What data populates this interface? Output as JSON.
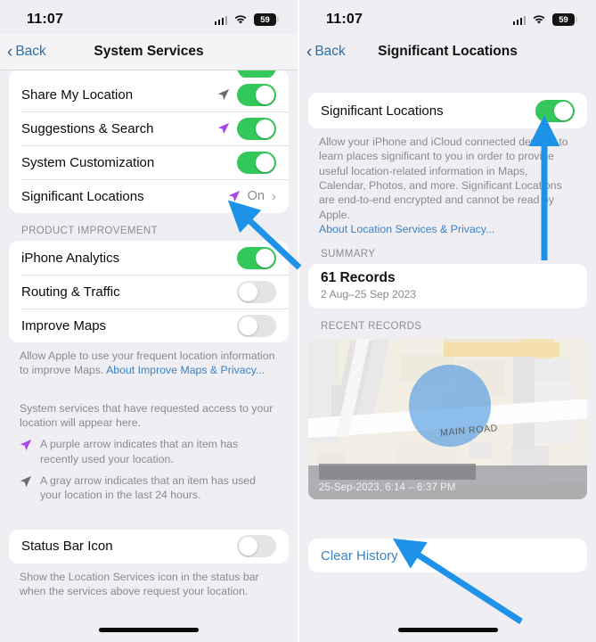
{
  "left_phone": {
    "status_bar": {
      "time": "11:07",
      "battery": "59",
      "wifi_icon": "wifi-icon",
      "signal_icon": "cellular-signal-icon"
    },
    "nav": {
      "back_label": "Back",
      "title": "System Services"
    },
    "rows": [
      {
        "label": "Share My Location",
        "arrow": "gray",
        "toggle": "on"
      },
      {
        "label": "Suggestions & Search",
        "arrow": "purple",
        "toggle": "on"
      },
      {
        "label": "System Customization",
        "arrow": "none",
        "toggle": "on"
      },
      {
        "label": "Significant Locations",
        "arrow": "purple",
        "value": "On",
        "disclosure": "›"
      }
    ],
    "section_product_improvement": "PRODUCT IMPROVEMENT",
    "improvement_rows": [
      {
        "label": "iPhone Analytics",
        "toggle": "on"
      },
      {
        "label": "Routing & Traffic",
        "toggle": "off"
      },
      {
        "label": "Improve Maps",
        "toggle": "off"
      }
    ],
    "improve_footnote": "Allow Apple to use your frequent location information to improve Maps. ",
    "improve_footnote_link": "About Improve Maps & Privacy...",
    "services_footnote": "System services that have requested access to your location will appear here.",
    "legend": [
      {
        "arrow": "purple",
        "text": "A purple arrow indicates that an item has recently used your location."
      },
      {
        "arrow": "gray",
        "text": "A gray arrow indicates that an item has used your location in the last 24 hours."
      }
    ],
    "status_bar_icon_row": {
      "label": "Status Bar Icon",
      "toggle": "off"
    },
    "status_bar_footnote": "Show the Location Services icon in the status bar when the services above request your location."
  },
  "right_phone": {
    "status_bar": {
      "time": "11:07",
      "battery": "59",
      "wifi_icon": "wifi-icon",
      "signal_icon": "cellular-signal-icon"
    },
    "nav": {
      "back_label": "Back",
      "title": "Significant Locations"
    },
    "main_row": {
      "label": "Significant Locations",
      "toggle": "on"
    },
    "description": "Allow your iPhone and iCloud connected devices to learn places significant to you in order to provide useful location-related information in Maps, Calendar, Photos, and more. Significant Locations are end-to-end encrypted and cannot be read by Apple.",
    "description_link": "About Location Services & Privacy...",
    "summary_header": "SUMMARY",
    "summary": {
      "title": "61 Records",
      "subtitle": "2 Aug–25 Sep 2023"
    },
    "recent_header": "RECENT RECORDS",
    "map": {
      "road_label": "MAIN ROAD",
      "caption": "25-Sep-2023, 6:14 – 6:37 PM"
    },
    "clear_history_label": "Clear History"
  },
  "annotations": {
    "arrow_color": "#1d92e8",
    "arrows": [
      {
        "name": "arrow-to-significant-locations-value",
        "desc": "diagonal arrow pointing up-left to the On value"
      },
      {
        "name": "arrow-to-significant-locations-toggle",
        "desc": "vertical arrow pointing up to the toggle"
      },
      {
        "name": "arrow-to-clear-history",
        "desc": "diagonal arrow pointing up-left to Clear History"
      }
    ]
  },
  "colors": {
    "accent_blue": "#3c82c4",
    "toggle_on_green": "#34c759",
    "purple_arrow": "#a845e8",
    "gray_arrow": "#6b6b70",
    "annotation_blue": "#1d92e8",
    "background": "#eeeef3"
  }
}
